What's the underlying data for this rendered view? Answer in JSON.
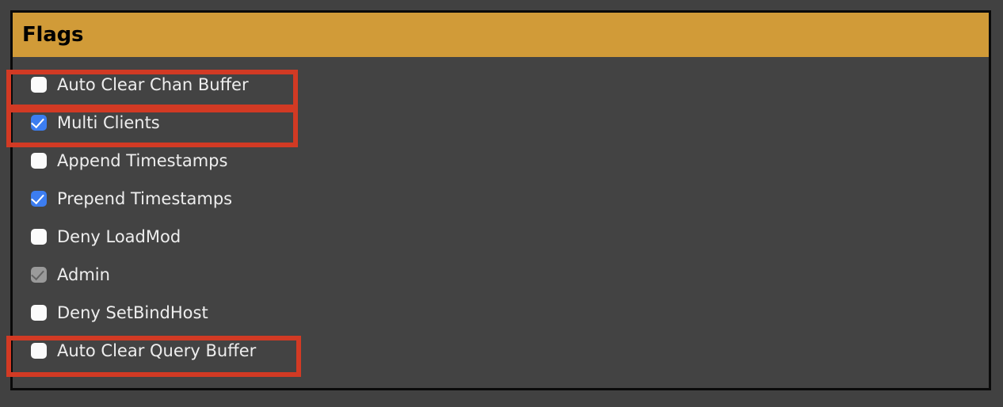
{
  "panel": {
    "title": "Flags",
    "header_color": "#d19b38",
    "body_color": "#434343",
    "border_color": "#0a0a0a"
  },
  "highlight": {
    "color": "#d23a24",
    "rows": [
      "Auto Clear Chan Buffer",
      "Multi Clients",
      "Auto Clear Query Buffer"
    ]
  },
  "flags": [
    {
      "label": "Auto Clear Chan Buffer",
      "checked": false,
      "disabled": false,
      "highlighted": true
    },
    {
      "label": "Multi Clients",
      "checked": true,
      "disabled": false,
      "highlighted": true
    },
    {
      "label": "Append Timestamps",
      "checked": false,
      "disabled": false,
      "highlighted": false
    },
    {
      "label": "Prepend Timestamps",
      "checked": true,
      "disabled": false,
      "highlighted": false
    },
    {
      "label": "Deny LoadMod",
      "checked": false,
      "disabled": false,
      "highlighted": false
    },
    {
      "label": "Admin",
      "checked": true,
      "disabled": true,
      "highlighted": false
    },
    {
      "label": "Deny SetBindHost",
      "checked": false,
      "disabled": false,
      "highlighted": false
    },
    {
      "label": "Auto Clear Query Buffer",
      "checked": false,
      "disabled": false,
      "highlighted": true
    }
  ]
}
